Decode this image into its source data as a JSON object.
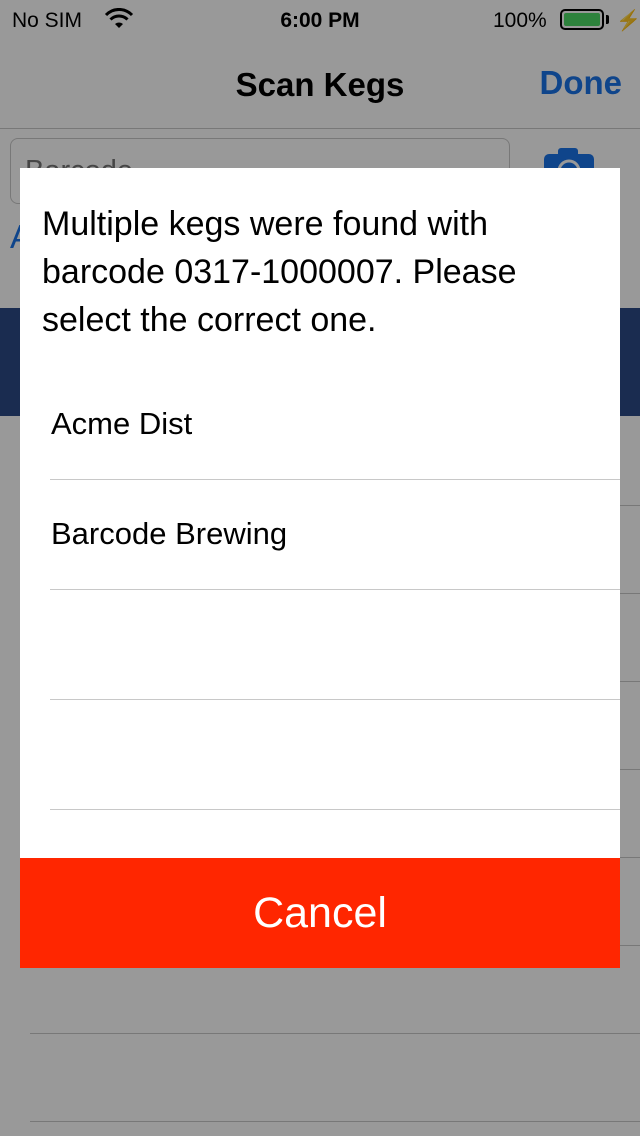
{
  "status_bar": {
    "carrier": "No SIM",
    "time": "6:00 PM",
    "battery_percent": "100%",
    "battery_level": 1.0,
    "icons": [
      "wifi-icon",
      "battery-icon",
      "charging-icon"
    ]
  },
  "nav": {
    "title": "Scan Kegs",
    "done_label": "Done"
  },
  "background": {
    "barcode_placeholder": "Barcode",
    "partial_label": "A",
    "icons": [
      "camera-icon"
    ]
  },
  "dialog": {
    "message": "Multiple kegs were found with barcode 0317-1000007. Please select the correct one.",
    "options": [
      {
        "label": "Acme Dist"
      },
      {
        "label": "Barcode Brewing"
      },
      {
        "label": ""
      },
      {
        "label": ""
      }
    ],
    "cancel_label": "Cancel"
  },
  "colors": {
    "accent": "#1a73e8",
    "cancel": "#ff2600",
    "battery": "#4cd964",
    "band": "#2c4a86"
  }
}
